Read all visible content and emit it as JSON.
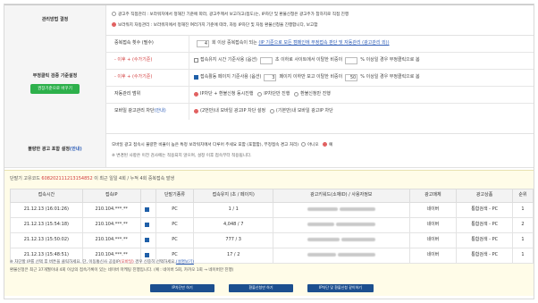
{
  "settings": {
    "method": {
      "label": "관리방법 결정",
      "opt1": "광고주 직접관리 : 보라워치에서 정해진 기준에 따라, 광고주께서 보고하고(접도)는, IP차단 및 환불신청은 광고주가 참하지로 직접 진행",
      "opt2": "보라워치 자동관리 : 보라워치에서 정해진 여러가지 기준에 따라, 자동 IP차단 및 자동 환불신청을 진행합니다, 보고함"
    },
    "fraud": {
      "label": "부정클릭 검증 기준설정",
      "button": "권장기준으로 바꾸기",
      "r1_label": "중복접속 횟수 (필수)",
      "r1_value": "4",
      "r1_text": "회 이상 중복접속이 되는",
      "r1_link": "(IP 기준으로 모든 캠페인에 부정접속 판단 및 자동관리 (광고관리 외))",
      "r2_label": "- 이후 + (수가기준)",
      "r2_text": "접속유지 시간 기준사용 (옵션)",
      "r2_pre": "",
      "r2_value": "",
      "r2_tail": "초 이하로 사이트에서 이탈한 비중이",
      "r2_pct": "",
      "r2_end": "% 이상일 경우 부정클릭으로 봄",
      "r3_label": "- 이후 + (수가기준)",
      "r3_text": "접속활동 페이지 기준사용 (옵션)",
      "r3_value": "3",
      "r3_tail": "페이지 이하만 보고 이탈한 비중이",
      "r3_pct": "50",
      "r3_end": "% 이상일 경우 부정클릭으로 봄",
      "r4_label": "자동관리 범위",
      "r4_opt1": "IP차단 + 환불신청 동시진행",
      "r4_opt2": "IP차단만 진행",
      "r4_opt3": "환불신청만 진행",
      "r5_label": "모바일 광고관리 차단",
      "r5_label_suffix": "(안내)",
      "r5_opt1": "(2번만)내 모바일 광고IP 차단 설정",
      "r5_opt2": "(기본만)내 모바일 광고IP 차단"
    },
    "invalid": {
      "label": "불량한 광고 포함 설정",
      "label_suffix": "(안내)",
      "text1": "모바일 광고 접속시 불량한 비율이 높은 특정 보라워치에서 다루어 주세요 포함 (포함함), 부정접속 경고 처리)",
      "opt_no": "아니오",
      "opt_yes": "예",
      "text2": "※ 변경된 사항은 이전 검사에는 적용되지 않으며, 설정 이후 접속부터 적용됩니다."
    }
  },
  "detail": {
    "title_prefix": "단말기 고유코드 ",
    "code": "608202111213154852",
    "title_mid": " 이 최근 일일 4회 / 누적 4회",
    "title_end": " 중복접속 발생",
    "headers": [
      "접속시간",
      "접속IP",
      "",
      "단말기종류",
      "접속유지 (초 / 페이지)",
      "광고키워드(소재ID) / 사용자정보",
      "광고매체",
      "광고상품",
      "순위"
    ],
    "rows": [
      {
        "time": "21.12.13 (16:01:26)",
        "ip": "210.104.***.**",
        "device": "PC",
        "stay": "1 / 1",
        "media": "네이버",
        "product": "통합검색 - PC",
        "rank": "1"
      },
      {
        "time": "21.12.13 (15:54:18)",
        "ip": "210.104.***.**",
        "device": "PC",
        "stay": "4,048 / 7",
        "media": "네이버",
        "product": "통합검색 - PC",
        "rank": "2"
      },
      {
        "time": "21.12.13 (15:50:02)",
        "ip": "210.104.***.**",
        "device": "PC",
        "stay": "777 / 3",
        "media": "네이버",
        "product": "통합검색 - PC",
        "rank": "1"
      },
      {
        "time": "21.12.13 (15:48:51)",
        "ip": "210.104.***.**",
        "device": "PC",
        "stay": "17 / 2",
        "media": "네이버",
        "product": "통합검색 - PC",
        "rank": "1"
      }
    ],
    "note1_a": "※ 차단할 IP를 선택 후 버튼을 클릭하세요. 단, 이동통신사 공용IP",
    "note1_b": "(모바일)",
    "note1_c": " 경우 신중히 선택하세요.",
    "note1_link": "(설명보기)",
    "note2": "환불신청은 최근 37개월이내 4회 이상의 접속기록이 있는 네이버 마케팅 진행입니다. (예 : 네이버 5회, 카카오 1회 → 네이버만 진행)",
    "btn_ip": "IP차단만 하기",
    "btn_refund": "환불신청만 하기",
    "btn_both": "IP차단 및 환불신청 같이하기"
  }
}
